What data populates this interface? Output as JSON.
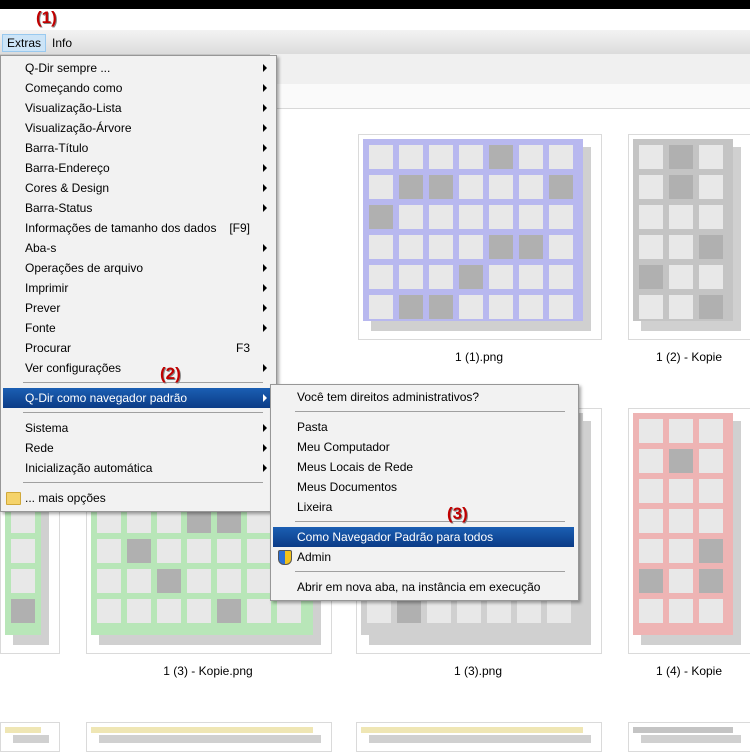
{
  "menubar": {
    "extras": "Extras",
    "info": "Info"
  },
  "badges": {
    "b1": "(1)",
    "b2": "(2)",
    "b3": "(3)"
  },
  "main_menu": {
    "items": [
      {
        "label": "Q-Dir sempre ...",
        "shortcut": ""
      },
      {
        "label": "Começando como",
        "shortcut": ""
      },
      {
        "label": "Visualização-Lista",
        "shortcut": ""
      },
      {
        "label": "Visualização-Árvore",
        "shortcut": ""
      },
      {
        "label": "Barra-Título",
        "shortcut": ""
      },
      {
        "label": "Barra-Endereço",
        "shortcut": ""
      },
      {
        "label": "Cores & Design",
        "shortcut": ""
      },
      {
        "label": "Barra-Status",
        "shortcut": ""
      },
      {
        "label": "Informações de tamanho dos dados",
        "shortcut": "[F9]"
      },
      {
        "label": "Aba-s",
        "shortcut": ""
      },
      {
        "label": "Operações de arquivo",
        "shortcut": ""
      },
      {
        "label": "Imprimir",
        "shortcut": ""
      },
      {
        "label": "Prever",
        "shortcut": ""
      },
      {
        "label": "Fonte",
        "shortcut": ""
      },
      {
        "label": "Procurar",
        "shortcut": "F3"
      },
      {
        "label": "Ver configurações",
        "shortcut": ""
      },
      {
        "label": "Q-Dir como navegador padrão",
        "shortcut": ""
      },
      {
        "label": "Sistema",
        "shortcut": ""
      },
      {
        "label": "Rede",
        "shortcut": ""
      },
      {
        "label": "Inicialização automática",
        "shortcut": ""
      },
      {
        "label": "... mais opções",
        "shortcut": ""
      }
    ]
  },
  "sub_menu": {
    "items": [
      {
        "label": "Você tem direitos administrativos?"
      },
      {
        "label": "Pasta"
      },
      {
        "label": "Meu Computador"
      },
      {
        "label": "Meus Locais de Rede"
      },
      {
        "label": "Meus Documentos"
      },
      {
        "label": "Lixeira"
      },
      {
        "label": "Como Navegador Padrão para todos"
      },
      {
        "label": "Admin"
      },
      {
        "label": "Abrir em nova aba, na instância em execução"
      }
    ]
  },
  "files": [
    {
      "name": "1 (1).png",
      "color": "#b8b8ef"
    },
    {
      "name": "1 (2) - Kopie",
      "color": "#c4c4c4"
    },
    {
      "name": "1 (3) - Kopie.png",
      "color": "#b8e6b8"
    },
    {
      "name": "1 (3).png",
      "color": "#d0d0d0"
    },
    {
      "name": "1 (4) - Kopie",
      "color": "#eeb4b4"
    },
    {
      "name": "",
      "color": "#efe6b4"
    }
  ],
  "colors": {
    "highlight": "#0b3b86",
    "badge": "#c00000"
  }
}
